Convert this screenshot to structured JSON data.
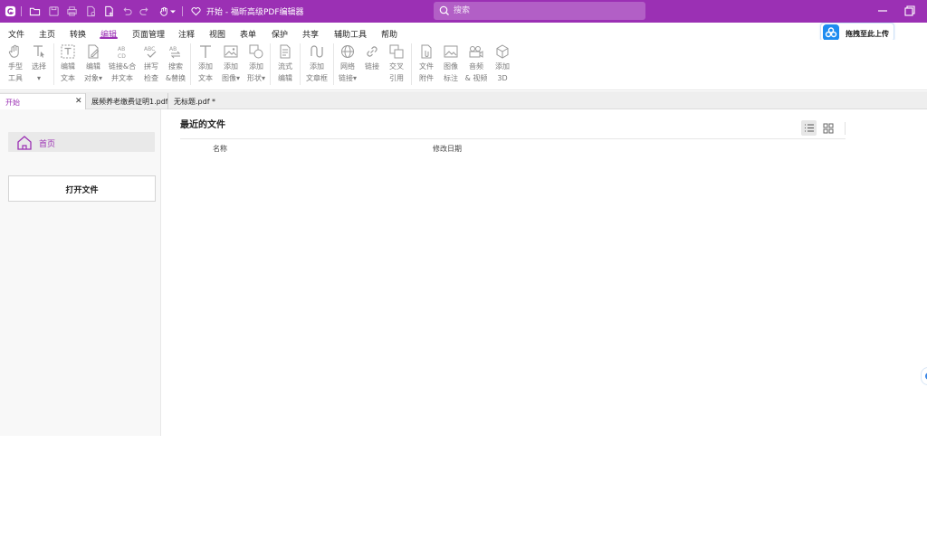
{
  "titlebar": {
    "title": "开始 - 福昕高级PDF编辑器",
    "search_placeholder": "搜索",
    "accent": "#9b30b4"
  },
  "menu": {
    "items": [
      "文件",
      "主页",
      "转换",
      "编辑",
      "页面管理",
      "注释",
      "视图",
      "表单",
      "保护",
      "共享",
      "辅助工具",
      "帮助"
    ],
    "active": "编辑"
  },
  "upload": {
    "label": "拖拽至此上传",
    "color": "#1d8cf0"
  },
  "ribbon": {
    "tools": [
      {
        "l1": "手型",
        "l2": "工具",
        "icon": "hand-icon"
      },
      {
        "l1": "选择",
        "l2": "▾",
        "icon": "select-text-icon"
      },
      {
        "l1": "编辑",
        "l2": "文本",
        "icon": "edit-text-icon"
      },
      {
        "l1": "编辑",
        "l2": "对象▾",
        "icon": "edit-object-icon"
      },
      {
        "l1": "链接&合",
        "l2": "并文本",
        "icon": "link-merge-icon"
      },
      {
        "l1": "拼写",
        "l2": "检查",
        "icon": "spell-check-icon"
      },
      {
        "l1": "搜索",
        "l2": "&替换",
        "icon": "search-replace-icon"
      },
      {
        "l1": "添加",
        "l2": "文本",
        "icon": "add-text-icon"
      },
      {
        "l1": "添加",
        "l2": "图像▾",
        "icon": "add-image-icon"
      },
      {
        "l1": "添加",
        "l2": "形状▾",
        "icon": "add-shape-icon"
      },
      {
        "l1": "流式",
        "l2": "编辑",
        "icon": "reflow-edit-icon"
      },
      {
        "l1": "添加",
        "l2": "文章框",
        "icon": "article-box-icon"
      },
      {
        "l1": "网络",
        "l2": "链接▾",
        "icon": "web-link-icon"
      },
      {
        "l1": "链接",
        "l2": "",
        "icon": "link-icon"
      },
      {
        "l1": "交叉",
        "l2": "引用",
        "icon": "cross-reference-icon"
      },
      {
        "l1": "文件",
        "l2": "附件",
        "icon": "file-attachment-icon"
      },
      {
        "l1": "图像",
        "l2": "标注",
        "icon": "image-annotation-icon"
      },
      {
        "l1": "音频",
        "l2": "& 视频",
        "icon": "audio-video-icon"
      },
      {
        "l1": "添加",
        "l2": "3D",
        "icon": "add-3d-icon"
      }
    ]
  },
  "tabs": [
    {
      "label": "开始",
      "active": true
    },
    {
      "label": "展频养老缴费证明1.pdf",
      "active": false
    },
    {
      "label": "无标题.pdf *",
      "active": false
    }
  ],
  "sidebar": {
    "home_label": "首页",
    "open_label": "打开文件"
  },
  "main": {
    "recent_title": "最近的文件",
    "col_name": "名称",
    "col_date": "修改日期"
  }
}
